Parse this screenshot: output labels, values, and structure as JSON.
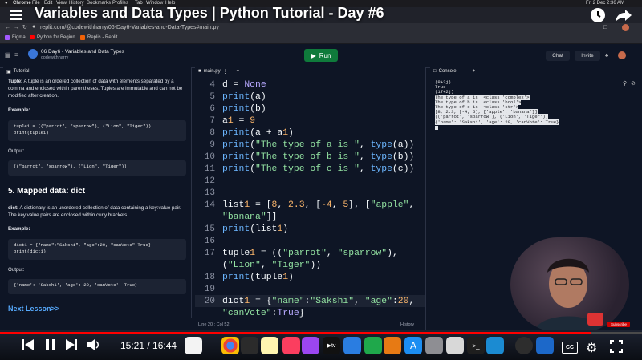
{
  "video": {
    "title": "Variables and Data Types | Python Tutorial - Day #6",
    "time": "15:21 / 16:44",
    "progress": 0.92,
    "subscribe_label": "Subscribe"
  },
  "menubar": {
    "app": "Chrome",
    "items": [
      "File",
      "Edit",
      "View",
      "History",
      "Bookmarks",
      "Profiles",
      "Tab",
      "Window",
      "Help"
    ],
    "datetime": "Fri 2 Dec  2:36 AM"
  },
  "browser": {
    "url": "replit.com/@codewithharry/06-Day6-Variables-and-Data-Types#main.py",
    "bookmarks": [
      "Figma",
      "Python for Beginn...",
      "Replis - Replit"
    ]
  },
  "repl": {
    "name": "06 Day6 - Variables and Data Types",
    "owner": "codewithharry",
    "run_label": "Run",
    "chat_label": "Chat",
    "invite_label": "Invite"
  },
  "tutorial": {
    "tab_label": "Tutorial",
    "tuple_term": "Tuple:",
    "tuple_desc": "A tuple is an ordered collection of data with elements separated by a comma and enclosed within parentheses. Tuples are immutable and can not be modified after creation.",
    "example_label": "Example:",
    "tuple_code_1": "tuple1 = ((\"parrot\", \"sparrow\"), (\"Lion\", \"Tiger\"))",
    "tuple_code_2": "print(tuple1)",
    "output_label": "Output:",
    "tuple_output": "((\"parrot\", \"sparrow\"), (\"Lion\", \"Tiger\"))",
    "section_heading": "5. Mapped data: dict",
    "dict_term": "dict:",
    "dict_desc": "A dictionary is an unordered collection of data containing a key:value pair. The key:value pairs are enclosed within curly brackets.",
    "example_label_2": "Example:",
    "dict_code_1": "dict1 = {\"name\":\"Sakshi\", \"age\":20, \"canVote\":True}",
    "dict_code_2": "print(dict1)",
    "output_label_2": "Output:",
    "dict_output": "{'name': 'Sakshi', 'age': 20, 'canVote': True}",
    "next_lesson": "Next Lesson>>"
  },
  "editor": {
    "tab_label": "main.py",
    "lines": [
      {
        "n": "4",
        "code": "d = None"
      },
      {
        "n": "5",
        "code": "print(a)"
      },
      {
        "n": "6",
        "code": "print(b)"
      },
      {
        "n": "7",
        "code": "a1 = 9"
      },
      {
        "n": "8",
        "code": "print(a + a1)"
      },
      {
        "n": "9",
        "code": "print(\"The type of a is \", type(a))"
      },
      {
        "n": "10",
        "code": "print(\"The type of b is \", type(b))"
      },
      {
        "n": "11",
        "code": "print(\"The type of c is \", type(c))"
      },
      {
        "n": "12",
        "code": ""
      },
      {
        "n": "13",
        "code": ""
      },
      {
        "n": "14",
        "code": "list1 = [8, 2.3, [-4, 5], [\"apple\","
      },
      {
        "n": "",
        "code": "\"banana\"]]"
      },
      {
        "n": "15",
        "code": "print(list1)"
      },
      {
        "n": "16",
        "code": ""
      },
      {
        "n": "17",
        "code": "tuple1 = ((\"parrot\", \"sparrow\"),"
      },
      {
        "n": "",
        "code": "(\"Lion\", \"Tiger\"))"
      },
      {
        "n": "18",
        "code": "print(tuple1)"
      },
      {
        "n": "19",
        "code": ""
      },
      {
        "n": "20",
        "code": "dict1 = {\"name\":\"Sakshi\", \"age\":20,"
      },
      {
        "n": "",
        "code": "\"canVote\":True}"
      }
    ],
    "status_left": "Line 20 : Col 52",
    "status_right": "History"
  },
  "console": {
    "tab_label": "Console",
    "lines": [
      {
        "text": "(8+2j)",
        "selected": false
      },
      {
        "text": "True",
        "selected": false
      },
      {
        "text": "(17+2j)",
        "selected": false
      },
      {
        "text": "The type of a is  <class 'complex'>",
        "selected": true
      },
      {
        "text": "The type of b is  <class 'bool'>",
        "selected": true
      },
      {
        "text": "The type of c is  <class 'str'>",
        "selected": true
      },
      {
        "text": "[8, 2.3, [-4, 5], ['apple', 'banana']]",
        "selected": true
      },
      {
        "text": "(('parrot', 'sparrow'), ('Lion', 'Tiger'))",
        "selected": true
      },
      {
        "text": "{'name': 'Sakshi', 'age': 20, 'canVote': True}",
        "selected": true
      }
    ]
  },
  "colors": {
    "run": "#0f7a3b",
    "progress": "#ff0000",
    "background": "#0e1525"
  }
}
